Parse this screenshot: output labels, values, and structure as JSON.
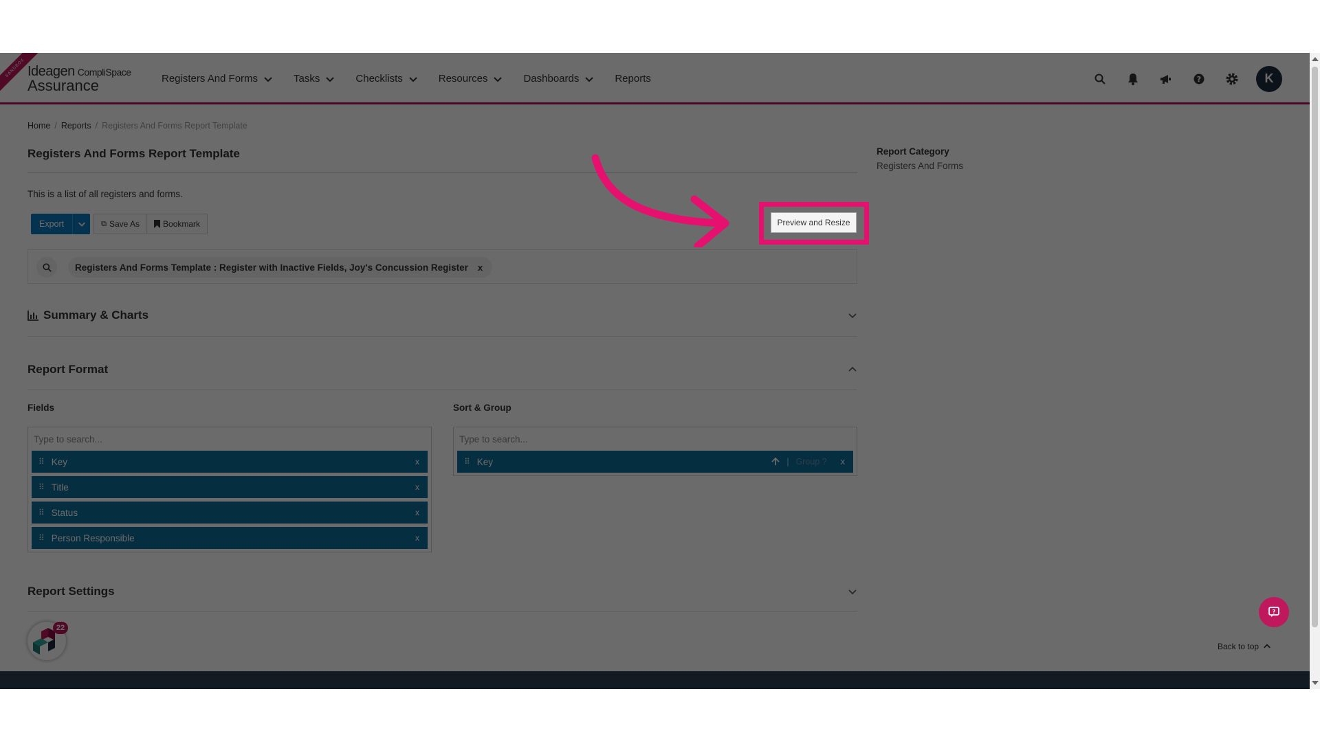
{
  "header": {
    "logo_brand": "Ideagen",
    "logo_sub": "CompliSpace",
    "logo_product": "Assurance",
    "ribbon": "SANDBOX",
    "nav": [
      {
        "label": "Registers And Forms",
        "has_dropdown": true
      },
      {
        "label": "Tasks",
        "has_dropdown": true
      },
      {
        "label": "Checklists",
        "has_dropdown": true
      },
      {
        "label": "Resources",
        "has_dropdown": true
      },
      {
        "label": "Dashboards",
        "has_dropdown": true
      },
      {
        "label": "Reports",
        "has_dropdown": false
      }
    ],
    "icons": [
      "search-icon",
      "bell-icon",
      "megaphone-icon",
      "help-icon",
      "gear-icon"
    ],
    "avatar_initial": "K",
    "accent_color": "#b5175a"
  },
  "breadcrumb": {
    "home": "Home",
    "reports": "Reports",
    "current": "Registers And Forms Report Template"
  },
  "page": {
    "title": "Registers And Forms Report Template",
    "description": "This is a list of all registers and forms."
  },
  "toolbar": {
    "export_label": "Export",
    "save_as_label": "Save As",
    "bookmark_label": "Bookmark",
    "preview_label": "Preview and Resize",
    "primary_color": "#0c7bbd"
  },
  "filter": {
    "chip_label": "Registers And Forms Template : Register with Inactive Fields, Joy's Concussion Register",
    "chip_remove": "x"
  },
  "sections": {
    "summary": "Summary & Charts",
    "format": "Report Format",
    "settings": "Report Settings"
  },
  "fields": {
    "label": "Fields",
    "placeholder": "Type to search...",
    "items": [
      "Key",
      "Title",
      "Status",
      "Person Responsible"
    ],
    "remove": "x"
  },
  "sort_group": {
    "label": "Sort & Group",
    "placeholder": "Type to search...",
    "items": [
      {
        "label": "Key",
        "group_label": "Group ?"
      }
    ],
    "separator": "|",
    "remove": "x"
  },
  "sidebar": {
    "category_title": "Report Category",
    "category_value": "Registers And Forms"
  },
  "footer": {
    "back_to_top": "Back to top",
    "badge_count": "22"
  },
  "annotation": {
    "highlight_color": "#e6106f"
  }
}
